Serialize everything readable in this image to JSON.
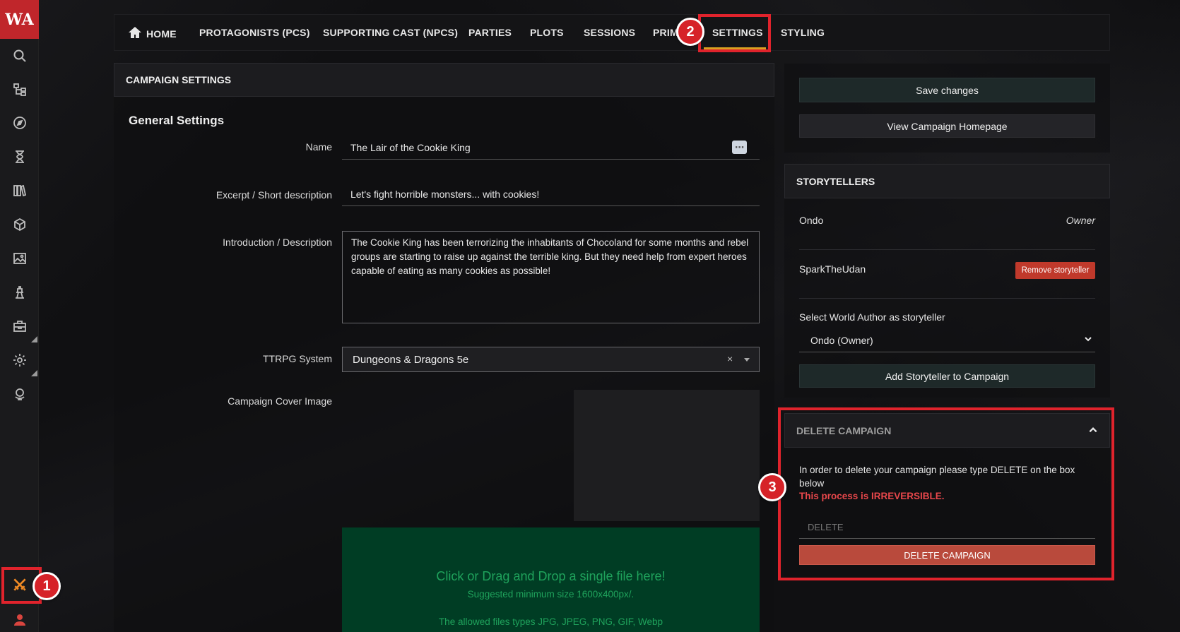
{
  "sidebar": {
    "logo": "WA",
    "icons": [
      "search-icon",
      "tree-icon",
      "compass-icon",
      "hourglass-icon",
      "books-icon",
      "cube-icon",
      "image-icon",
      "tower-icon",
      "toolbox-icon",
      "gear-icon",
      "globe-icon",
      "swords-icon",
      "user-icon"
    ]
  },
  "nav": {
    "home": "HOME",
    "pcs": "PROTAGONISTS (PCS)",
    "npcs": "SUPPORTING CAST (NPCS)",
    "parties": "PARTIES",
    "plots": "PLOTS",
    "sessions": "SESSIONS",
    "prim": "PRIM",
    "settings": "SETTINGS",
    "styling": "STYLING"
  },
  "annotations": {
    "one": "1",
    "two": "2",
    "three": "3"
  },
  "campaign_settings": {
    "header": "CAMPAIGN SETTINGS",
    "section_title": "General Settings",
    "name_label": "Name",
    "name_value": "The Lair of the Cookie King",
    "excerpt_label": "Excerpt / Short description",
    "excerpt_value": "Let's fight horrible monsters... with cookies!",
    "intro_label": "Introduction / Description",
    "intro_value": "The Cookie King has been terrorizing the inhabitants of Chocoland for some months and rebel groups are starting to raise up against the terrible king. But they need help from expert heroes capable of eating as many cookies as possible!",
    "system_label": "TTRPG System",
    "system_value": "Dungeons & Dragons 5e",
    "cover_label": "Campaign Cover Image",
    "dropzone": {
      "title": "Click or Drag and Drop a single file here!",
      "size_hint": "Suggested minimum size 1600x400px/.",
      "types_hint": "The allowed files types JPG, JPEG, PNG, GIF, Webp"
    }
  },
  "actions": {
    "save": "Save changes",
    "view_home": "View Campaign Homepage"
  },
  "storytellers": {
    "header": "STORYTELLERS",
    "list": [
      {
        "name": "Ondo",
        "role": "Owner"
      },
      {
        "name": "SparkTheUdan",
        "action": "Remove storyteller"
      }
    ],
    "select_label": "Select World Author as storyteller",
    "select_value": "Ondo (Owner)",
    "add_button": "Add Storyteller to Campaign"
  },
  "delete": {
    "header": "DELETE CAMPAIGN",
    "instructions": "In order to delete your campaign please type DELETE on the box below",
    "warning": "This process is IRREVERSIBLE.",
    "placeholder": "DELETE",
    "button": "DELETE CAMPAIGN"
  },
  "colors": {
    "brand_red": "#c0262b",
    "annotation_red": "#e0232c",
    "dropzone_green": "#003d24",
    "dropzone_text": "#1fa35c",
    "warning_text": "#e8474b"
  }
}
